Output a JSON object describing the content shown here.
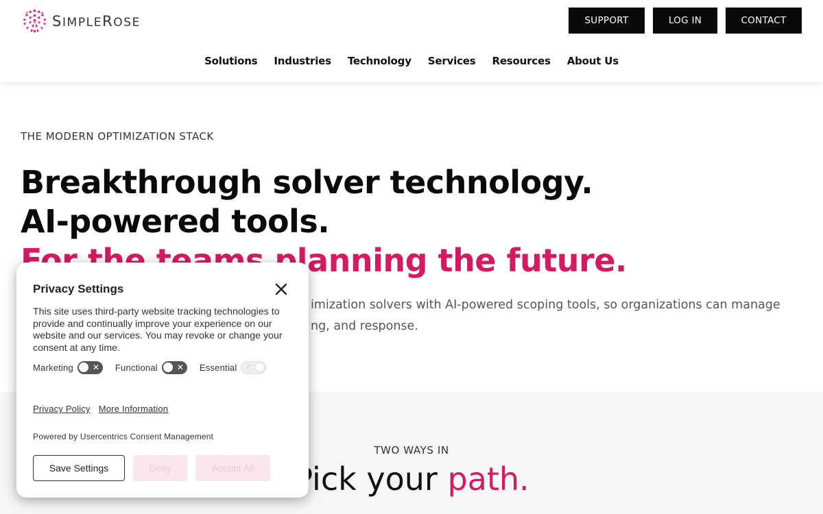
{
  "brand": {
    "logo_text_cap1": "S",
    "logo_text_rest1": "IMPLE",
    "logo_text_cap2": "R",
    "logo_text_rest2": "OSE",
    "accent_color": "#d41b62"
  },
  "header": {
    "buttons": {
      "support": "SUPPORT",
      "login": "LOG IN",
      "contact": "CONTACT"
    },
    "nav": [
      "Solutions",
      "Industries",
      "Technology",
      "Services",
      "Resources",
      "About Us"
    ]
  },
  "hero": {
    "eyebrow": "THE MODERN OPTIMIZATION STACK",
    "line1": "Breakthrough solver technology.",
    "line2": "AI-powered tools.",
    "line3": "For the teams planning the future.",
    "para_line1": "imization solvers with AI-powered scoping tools, so organizations can manage",
    "para_line2": "ng, and response."
  },
  "section2": {
    "eyebrow": "TWO WAYS IN",
    "title_part1": "Pick your ",
    "title_part2": "path."
  },
  "privacy": {
    "title": "Privacy Settings",
    "text": "This site uses third-party website tracking technologies to provide and continually improve your experience on our website and our services. You may revoke or change your consent at any time.",
    "toggles": {
      "marketing": "Marketing",
      "functional": "Functional",
      "essential": "Essential"
    },
    "links": {
      "policy": "Privacy Policy",
      "more": "More Information"
    },
    "powered": "Powered by Usercentrics Consent Management",
    "buttons": {
      "save": "Save Settings",
      "deny": "Deny",
      "accept": "Accept All"
    }
  }
}
